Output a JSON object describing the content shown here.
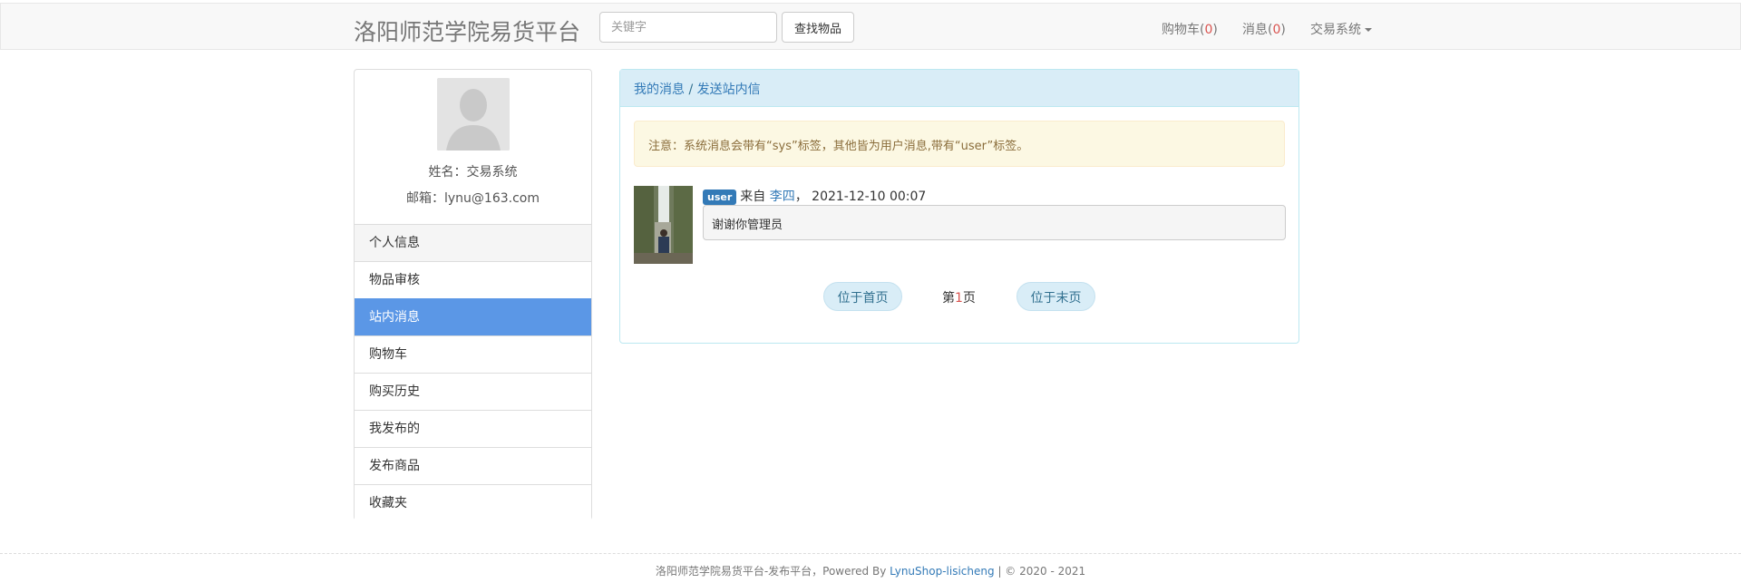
{
  "header": {
    "brand": "洛阳师范学院易货平台",
    "search_placeholder": "关键字",
    "search_button": "查找物品",
    "cart_label": "购物车",
    "cart_count": "0",
    "messages_label": "消息",
    "messages_count": "0",
    "account_label": "交易系统"
  },
  "profile": {
    "name_line": "姓名：交易系统",
    "email_line": "邮箱：lynu@163.com"
  },
  "sidebar": {
    "items": [
      {
        "label": "个人信息"
      },
      {
        "label": "物品审核"
      },
      {
        "label": "站内消息"
      },
      {
        "label": "购物车"
      },
      {
        "label": "购买历史"
      },
      {
        "label": "我发布的"
      },
      {
        "label": "发布商品"
      },
      {
        "label": "收藏夹"
      }
    ],
    "active_index": 2
  },
  "messages": {
    "breadcrumb_my": "我的消息",
    "breadcrumb_sep": " / ",
    "breadcrumb_send": "发送站内信",
    "notice": "注意：系统消息会带有“sys”标签，其他皆为用户消息,带有“user”标签。",
    "item": {
      "tag": "user",
      "from_prefix": "来自",
      "sender": "李四",
      "separator": "，",
      "time": "2021-12-10 00:07",
      "content": "谢谢你管理员"
    },
    "pager": {
      "first": "位于首页",
      "page_prefix": "第",
      "page_number": "1",
      "page_suffix": "页",
      "last": "位于末页"
    }
  },
  "footer": {
    "text": "洛阳师范学院易货平台-发布平台，Powered By ",
    "link": "LynuShop-lisicheng",
    "copyright": " | © 2020 - 2021"
  },
  "colors": {
    "active_menu": "#5b97e6",
    "panel_heading": "#d9edf7",
    "alert_bg": "#fcf8e3",
    "badge": "#337ab7"
  }
}
